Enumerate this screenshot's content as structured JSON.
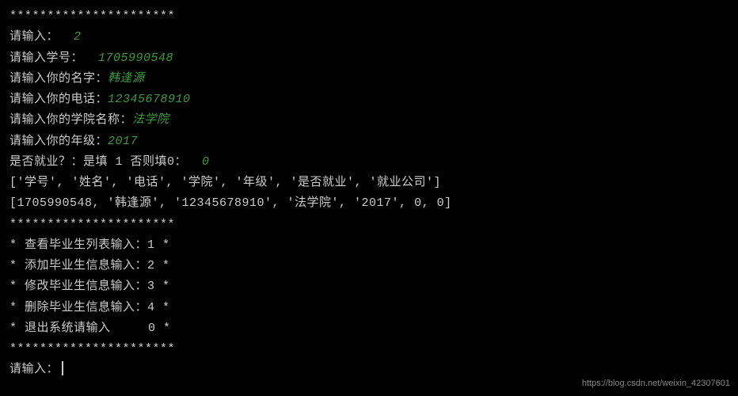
{
  "lines": {
    "stars": "**********************",
    "prompt1": {
      "label": "请输入：  ",
      "value": "2"
    },
    "prompt2": {
      "label": "请输入学号：  ",
      "value": "1705990548"
    },
    "prompt3": {
      "label": "请输入你的名字：",
      "value": "韩逢源"
    },
    "prompt4": {
      "label": "请输入你的电话：",
      "value": "12345678910"
    },
    "prompt5": {
      "label": "请输入你的学院名称：",
      "value": "法学院"
    },
    "prompt6": {
      "label": "请输入你的年级：",
      "value": "2017"
    },
    "prompt7": {
      "label": "是否就业？：是填 1 否则填0：  ",
      "value": "0"
    },
    "array1": "['学号', '姓名', '电话', '学院', '年级', '是否就业', '就业公司']",
    "array2": "[1705990548, '韩逢源', '12345678910', '法学院', '2017', 0, 0]",
    "menu1": "* 查看毕业生列表输入：1 *",
    "menu2": "* 添加毕业生信息输入：2 *",
    "menu3": "* 修改毕业生信息输入：3 *",
    "menu4": "* 删除毕业生信息输入：4 *",
    "menu5": "* 退出系统请输入     0 *",
    "finalPrompt": "请输入："
  },
  "watermark": "https://blog.csdn.net/weixin_42307601"
}
